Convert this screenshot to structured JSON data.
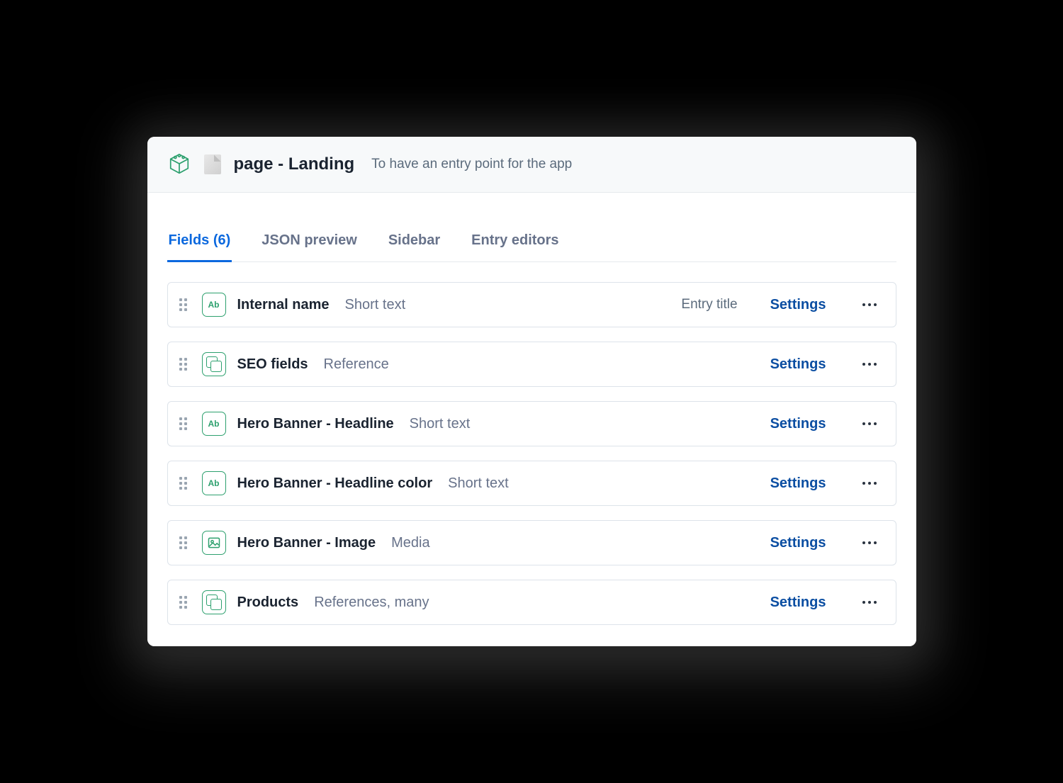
{
  "header": {
    "title": "page - Landing",
    "subtitle": "To have an entry point for the app"
  },
  "tabs": [
    {
      "label": "Fields (6)",
      "active": true
    },
    {
      "label": "JSON preview",
      "active": false
    },
    {
      "label": "Sidebar",
      "active": false
    },
    {
      "label": "Entry editors",
      "active": false
    }
  ],
  "actions": {
    "settings_label": "Settings"
  },
  "fields": [
    {
      "icon": "text",
      "name": "Internal name",
      "type": "Short text",
      "badge": "Entry title"
    },
    {
      "icon": "reference",
      "name": "SEO fields",
      "type": "Reference",
      "badge": ""
    },
    {
      "icon": "text",
      "name": "Hero Banner - Headline",
      "type": "Short text",
      "badge": ""
    },
    {
      "icon": "text",
      "name": "Hero Banner - Headline color",
      "type": "Short text",
      "badge": ""
    },
    {
      "icon": "media",
      "name": "Hero Banner - Image",
      "type": "Media",
      "badge": ""
    },
    {
      "icon": "reference",
      "name": "Products",
      "type": "References, many",
      "badge": ""
    }
  ]
}
